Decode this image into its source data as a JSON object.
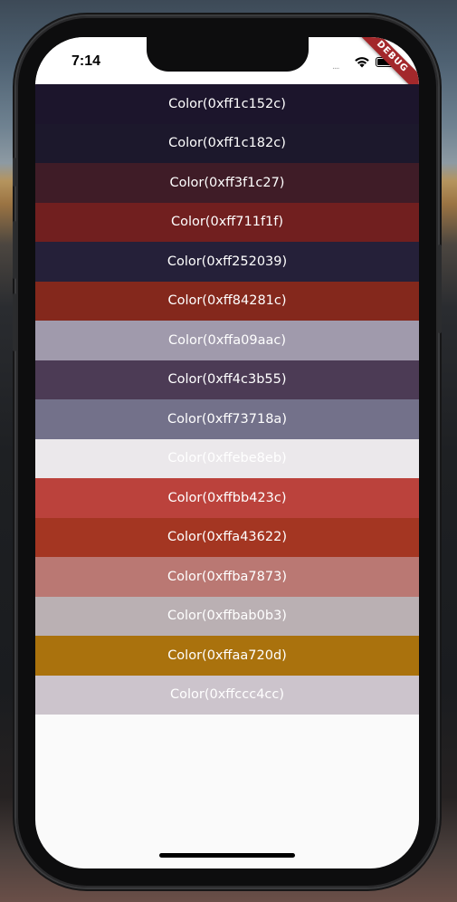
{
  "status_bar": {
    "time": "7:14",
    "signal": "....",
    "debug_banner": "DEBUG",
    "wifi_icon": "wifi-icon",
    "battery_icon": "battery-icon"
  },
  "colors": [
    {
      "label": "Color(0xff1c152c)",
      "hex": "#1c152c"
    },
    {
      "label": "Color(0xff1c182c)",
      "hex": "#1c182c"
    },
    {
      "label": "Color(0xff3f1c27)",
      "hex": "#3f1c27"
    },
    {
      "label": "Color(0xff711f1f)",
      "hex": "#711f1f"
    },
    {
      "label": "Color(0xff252039)",
      "hex": "#252039"
    },
    {
      "label": "Color(0xff84281c)",
      "hex": "#84281c"
    },
    {
      "label": "Color(0xffa09aac)",
      "hex": "#a09aac"
    },
    {
      "label": "Color(0xff4c3b55)",
      "hex": "#4c3b55"
    },
    {
      "label": "Color(0xff73718a)",
      "hex": "#73718a"
    },
    {
      "label": "Color(0xffebe8eb)",
      "hex": "#ebe8eb"
    },
    {
      "label": "Color(0xffbb423c)",
      "hex": "#bb423c"
    },
    {
      "label": "Color(0xffa43622)",
      "hex": "#a43622"
    },
    {
      "label": "Color(0xffba7873)",
      "hex": "#ba7873"
    },
    {
      "label": "Color(0xffbab0b3)",
      "hex": "#bab0b3"
    },
    {
      "label": "Color(0xffaa720d)",
      "hex": "#aa720d"
    },
    {
      "label": "Color(0xffccc4cc)",
      "hex": "#ccc4cc"
    }
  ]
}
